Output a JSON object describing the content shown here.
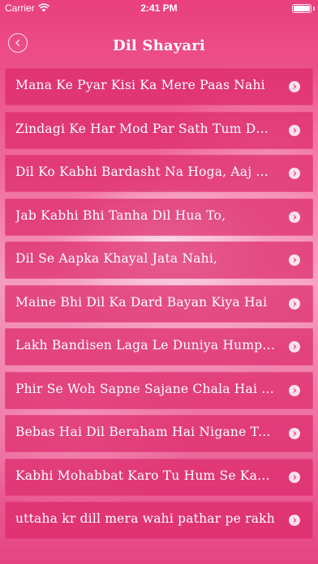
{
  "status_bar": {
    "carrier": "Carrier",
    "time": "2:41 PM",
    "wifi_icon": "wifi-icon",
    "battery_icon": "battery-icon"
  },
  "nav": {
    "title": "Dil Shayari",
    "back_icon": "chevron-left-circle-icon"
  },
  "items": [
    {
      "label": "Mana Ke Pyar Kisi Ka Mere Paas Nahi"
    },
    {
      "label": "Zindagi Ke Har Mod Par Sath Tum Dena"
    },
    {
      "label": "Dil Ko Kabhi Bardasht Na Hoga, Aaj Bhi"
    },
    {
      "label": "Jab Kabhi Bhi Tanha Dil Hua To,"
    },
    {
      "label": "Dil Se Aapka Khayal Jata Nahi,"
    },
    {
      "label": "Maine Bhi Dil Ka Dard Bayan Kiya Hai"
    },
    {
      "label": "Lakh Bandisen Laga Le Duniya Humpar"
    },
    {
      "label": "Phir Se Woh Sapne Sajane Chala Hai Dil"
    },
    {
      "label": "Bebas Hai Dil Beraham Hai Nigane Teri"
    },
    {
      "label": "Kabhi Mohabbat Karo Tu Hum Se Karna"
    },
    {
      "label": "uttaha kr dill mera wahi pathar pe rakh"
    }
  ],
  "colors": {
    "accent": "#e23a78",
    "row_bg": "#dc2869",
    "text": "#ffffff"
  }
}
